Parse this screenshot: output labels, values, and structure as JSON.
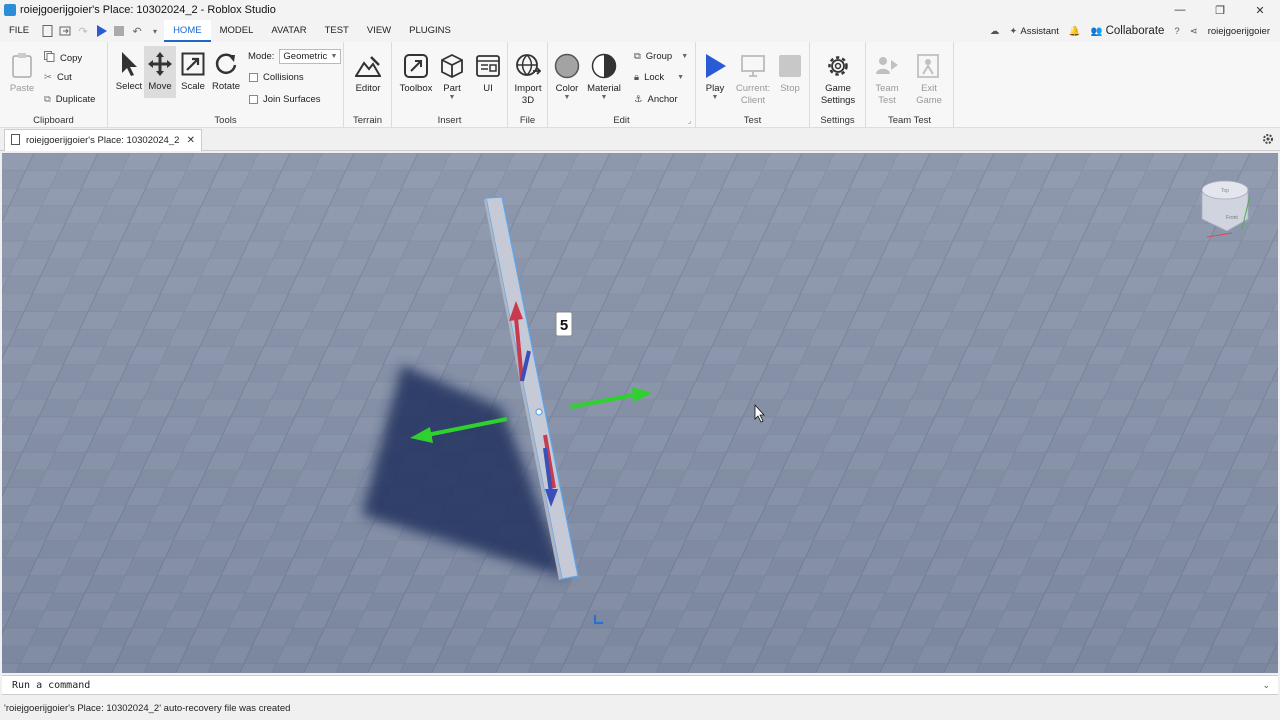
{
  "window": {
    "title": "roiejgoerijgoier's Place: 10302024_2 - Roblox Studio",
    "minimize": "—",
    "maximize": "❐",
    "close": "✕"
  },
  "menubar": {
    "file": "FILE",
    "tabs": [
      {
        "label": "HOME",
        "active": true
      },
      {
        "label": "MODEL"
      },
      {
        "label": "AVATAR"
      },
      {
        "label": "TEST"
      },
      {
        "label": "VIEW"
      },
      {
        "label": "PLUGINS"
      }
    ],
    "assistant": "Assistant",
    "collaborate": "Collaborate",
    "username": "roiejgoerijgoier"
  },
  "ribbon": {
    "clipboard": {
      "paste": "Paste",
      "copy": "Copy",
      "cut": "Cut",
      "duplicate": "Duplicate",
      "label": "Clipboard"
    },
    "tools": {
      "select": "Select",
      "move": "Move",
      "scale": "Scale",
      "rotate": "Rotate",
      "mode_label": "Mode:",
      "mode_value": "Geometric",
      "collisions": "Collisions",
      "join_surfaces": "Join Surfaces",
      "label": "Tools"
    },
    "terrain": {
      "editor": "Editor",
      "label": "Terrain"
    },
    "insert": {
      "toolbox": "Toolbox",
      "part": "Part",
      "ui": "UI",
      "label": "Insert"
    },
    "file": {
      "import_line1": "Import",
      "import_line2": "3D",
      "label": "File"
    },
    "edit": {
      "color": "Color",
      "material": "Material",
      "group": "Group",
      "lock": "Lock",
      "anchor": "Anchor",
      "label": "Edit"
    },
    "test": {
      "play": "Play",
      "current_line1": "Current:",
      "current_line2": "Client",
      "stop": "Stop",
      "label": "Test"
    },
    "settings": {
      "game_line1": "Game",
      "game_line2": "Settings",
      "label": "Settings"
    },
    "team_test": {
      "team_line1": "Team",
      "team_line2": "Test",
      "exit_line1": "Exit",
      "exit_line2": "Game",
      "label": "Team Test"
    }
  },
  "document_tab": {
    "label": "roiejgoerijgoier's Place: 10302024_2",
    "close": "✕"
  },
  "viewport": {
    "selection_count": "5",
    "cube_top": "Top",
    "cube_front": "Front"
  },
  "command_bar": {
    "placeholder": "Run a command",
    "chevron": "⌄"
  },
  "status": {
    "message": "'roiejgoerijgoier's Place: 10302024_2' auto-recovery file was created"
  },
  "colors": {
    "accent": "#1b6ac9",
    "play": "#2a5bd7",
    "floor": "#7f8aa1",
    "axis_red": "#c73a50",
    "axis_green": "#2ed12e",
    "axis_blue": "#3a4fb8"
  }
}
